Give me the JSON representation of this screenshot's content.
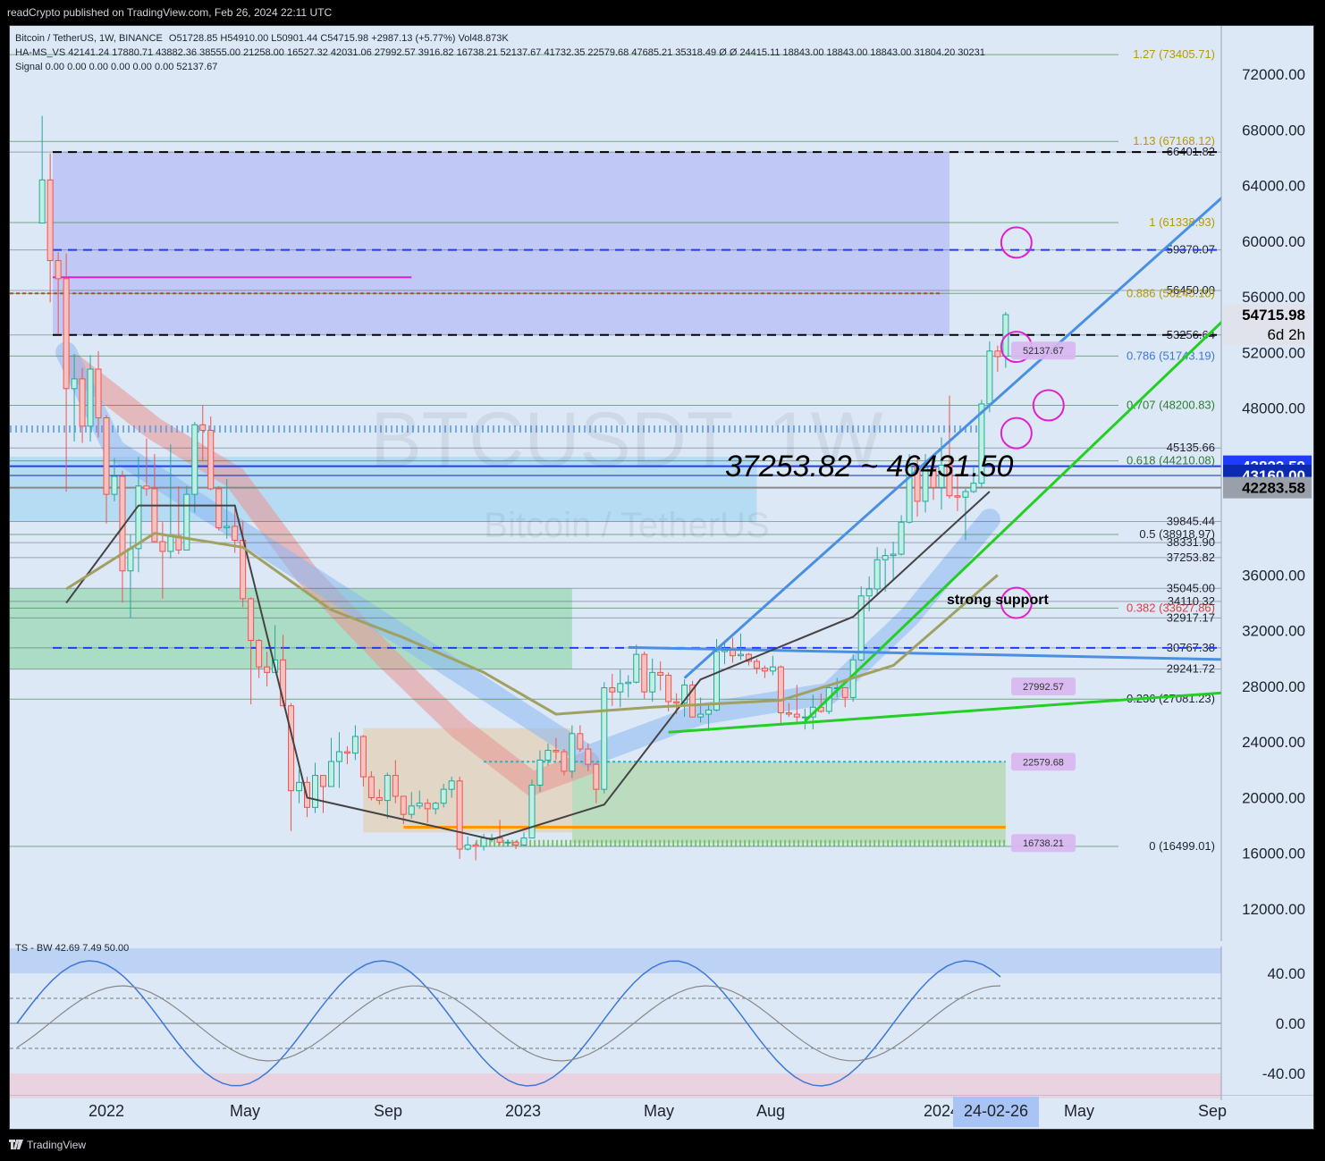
{
  "header": {
    "published": "readCrypto published on TradingView.com, Feb 26, 2024 22:11 UTC"
  },
  "symbol": {
    "name": "Bitcoin / TetherUS, 1W, BINANCE",
    "ohlc": "O51728.85 H54910.00 L50901.44 C54715.98 +2987.13 (+5.77%) Vol48.873K",
    "watermark": "BTCUSDT, 1W",
    "watermark_sub": "Bitcoin / TetherUS"
  },
  "indicators": {
    "ha_ms": "HA-MS_VS  42141.24  17880.71  43882.36  38555.00  21258.00  16527.32  42031.06  27992.57  3916.82  16738.21  52137.67  41732.35  22579.68  47685.21  35318.49  Ø  Ø  24415.11  18843.00  18843.00  18843.00  31804.20  30231",
    "signal": "Signal  0.00  0.00  0.00  0.00  0.00  0.00  52137.67",
    "oscillator": "TS - BW  42.69  7.49  50.00"
  },
  "colors": {
    "bg": "#dde8f7",
    "up": "#26a69a",
    "down": "#ef5350",
    "fib_line": "#2e7d32",
    "trend_blue": "#4a90e2",
    "trend_green": "#22d022",
    "box_blue": "#8a8ff0",
    "cloud_red": "#e89a98",
    "cloud_blue": "#8ab8f2",
    "magenta": "#e020d0",
    "orange": "#ff9800",
    "olive": "#a0a060"
  },
  "price_axis": {
    "ticks": [
      "72000.00",
      "68000.00",
      "64000.00",
      "60000.00",
      "56000.00",
      "52000.00",
      "48000.00",
      "36000.00",
      "32000.00",
      "28000.00",
      "24000.00",
      "20000.00",
      "16000.00",
      "12000.00"
    ],
    "current_price": "54715.98",
    "countdown": "6d 2h",
    "tag_blue": "43823.59",
    "tag_dark_blue": "43160.00",
    "tag_grey": "42283.58"
  },
  "fib_labels": [
    {
      "text": "1.27 (73405.71)",
      "value": 73405.71
    },
    {
      "text": "1.13 (67168.12)",
      "value": 67168.12
    },
    {
      "text": "1 (61338.93)",
      "value": 61338.93
    },
    {
      "text": "0.886 (56245.10)",
      "value": 56245.1
    },
    {
      "text": "0.786 (51743.19)",
      "value": 51743.19
    },
    {
      "text": "0.707 (48200.83)",
      "value": 48200.83
    },
    {
      "text": "0.618 (44210.08)",
      "value": 44210.08
    },
    {
      "text": "0.5 (38918.97)",
      "value": 38918.97
    },
    {
      "text": "0.382 (33627.86)",
      "value": 33627.86
    },
    {
      "text": "0.236 (27081.23)",
      "value": 27081.23
    },
    {
      "text": "0 (16499.01)",
      "value": 16499.01
    }
  ],
  "level_labels": [
    {
      "text": "66401.82",
      "value": 66401.82
    },
    {
      "text": "59370.07",
      "value": 59370.07
    },
    {
      "text": "56450.00",
      "value": 56450
    },
    {
      "text": "53256.64",
      "value": 53256.64
    },
    {
      "text": "45135.66",
      "value": 45135.66
    },
    {
      "text": "39845.44",
      "value": 39845.44
    },
    {
      "text": "38331.90",
      "value": 38331.9
    },
    {
      "text": "37253.82",
      "value": 37253.82
    },
    {
      "text": "35045.00",
      "value": 35045
    },
    {
      "text": "34110.32",
      "value": 34110.32
    },
    {
      "text": "32917.17",
      "value": 32917.17
    },
    {
      "text": "30767.38",
      "value": 30767.38
    },
    {
      "text": "29241.72",
      "value": 29241.72
    }
  ],
  "box_labels": [
    {
      "text": "52137.67",
      "value": 52137.67
    },
    {
      "text": "27992.57",
      "value": 27992.57
    },
    {
      "text": "22579.68",
      "value": 22579.68
    },
    {
      "text": "16738.21",
      "value": 16738.21
    }
  ],
  "annotations": {
    "range": "37253.82 ~ 46431.50",
    "support": "strong support"
  },
  "time_axis": {
    "labels": [
      "2022",
      "May",
      "Sep",
      "2023",
      "May",
      "Aug",
      "2024",
      "May",
      "Sep"
    ],
    "current_date": "24-02-26"
  },
  "osc_axis": {
    "ticks": [
      "40.00",
      "0.00",
      "-40.00"
    ]
  },
  "footer": {
    "brand": "TradingView"
  },
  "chart_data": {
    "type": "candlestick",
    "title": "BTCUSDT, 1W",
    "interval": "1W",
    "ylim": [
      10000,
      76000
    ],
    "x_start": "2021-11-01",
    "x_end": "2024-09-30",
    "series": [
      {
        "name": "Bitcoin / TetherUS",
        "points": [
          [
            "2021-11-08",
            61300,
            69000,
            62900,
            64400
          ],
          [
            "2021-11-15",
            64400,
            66300,
            55600,
            58600
          ],
          [
            "2021-11-22",
            58600,
            59200,
            53300,
            57300
          ],
          [
            "2021-11-29",
            57300,
            59100,
            42000,
            49400
          ],
          [
            "2021-12-06",
            49400,
            51900,
            45600,
            50100
          ],
          [
            "2021-12-13",
            50100,
            50900,
            45500,
            46700
          ],
          [
            "2021-12-20",
            46700,
            51800,
            45600,
            50800
          ],
          [
            "2021-12-27",
            50800,
            52100,
            45900,
            47300
          ],
          [
            "2022-01-03",
            47300,
            47500,
            39700,
            41800
          ],
          [
            "2022-01-10",
            41800,
            44400,
            41300,
            43100
          ],
          [
            "2022-01-17",
            43100,
            43500,
            34000,
            36300
          ],
          [
            "2022-01-24",
            36300,
            38900,
            32900,
            37900
          ],
          [
            "2022-01-31",
            37900,
            44500,
            36200,
            42400
          ],
          [
            "2022-02-07",
            42400,
            45800,
            41700,
            42200
          ],
          [
            "2022-02-14",
            42200,
            44700,
            39400,
            38400
          ],
          [
            "2022-02-21",
            38400,
            39800,
            34300,
            37700
          ],
          [
            "2022-02-28",
            37700,
            45400,
            37200,
            38800
          ],
          [
            "2022-03-07",
            38800,
            42400,
            37500,
            37800
          ],
          [
            "2022-03-14",
            37800,
            42400,
            38300,
            41800
          ],
          [
            "2022-03-21",
            41800,
            47000,
            40500,
            46800
          ],
          [
            "2022-03-28",
            46800,
            48200,
            44200,
            46400
          ],
          [
            "2022-04-04",
            46400,
            47400,
            42100,
            42200
          ],
          [
            "2022-04-11",
            42200,
            42400,
            39200,
            39400
          ],
          [
            "2022-04-18",
            39400,
            42900,
            38600,
            39500
          ],
          [
            "2022-04-25",
            39500,
            40800,
            37600,
            38500
          ],
          [
            "2022-05-02",
            38500,
            39900,
            33700,
            34300
          ],
          [
            "2022-05-09",
            34300,
            34400,
            26700,
            31300
          ],
          [
            "2022-05-16",
            31300,
            31400,
            28600,
            29400
          ],
          [
            "2022-05-23",
            29400,
            30500,
            28000,
            29000
          ],
          [
            "2022-05-30",
            29000,
            32400,
            29300,
            29900
          ],
          [
            "2022-06-06",
            29900,
            31700,
            26600,
            26600
          ],
          [
            "2022-06-13",
            26600,
            26800,
            17600,
            20500
          ],
          [
            "2022-06-20",
            20500,
            22000,
            19600,
            21100
          ],
          [
            "2022-06-27",
            21100,
            21500,
            18600,
            19300
          ],
          [
            "2022-07-04",
            19300,
            22500,
            18900,
            21600
          ],
          [
            "2022-07-11",
            21600,
            21600,
            18900,
            20800
          ],
          [
            "2022-07-18",
            20800,
            24300,
            20800,
            22600
          ],
          [
            "2022-07-25",
            22600,
            24700,
            20700,
            23300
          ],
          [
            "2022-08-01",
            23300,
            23700,
            22400,
            23200
          ],
          [
            "2022-08-08",
            23200,
            25200,
            22700,
            24400
          ],
          [
            "2022-08-15",
            24400,
            24500,
            20800,
            21500
          ],
          [
            "2022-08-22",
            21500,
            21900,
            19800,
            20000
          ],
          [
            "2022-08-29",
            20000,
            20600,
            19500,
            19800
          ],
          [
            "2022-09-05",
            19800,
            21800,
            18500,
            21600
          ],
          [
            "2022-09-12",
            21600,
            22700,
            19600,
            20100
          ],
          [
            "2022-09-19",
            20100,
            20100,
            18100,
            18800
          ],
          [
            "2022-09-26",
            18800,
            20400,
            18500,
            19400
          ],
          [
            "2022-10-03",
            19400,
            20500,
            19200,
            19600
          ],
          [
            "2022-10-10",
            19600,
            19900,
            18200,
            19200
          ],
          [
            "2022-10-17",
            19200,
            19700,
            18800,
            19600
          ],
          [
            "2022-10-24",
            19600,
            21000,
            19300,
            20600
          ],
          [
            "2022-10-31",
            20600,
            21500,
            20000,
            21200
          ],
          [
            "2022-11-07",
            21200,
            21500,
            15600,
            16300
          ],
          [
            "2022-11-14",
            16300,
            17200,
            16200,
            16600
          ],
          [
            "2022-11-21",
            16600,
            16800,
            15500,
            16500
          ],
          [
            "2022-11-28",
            16500,
            17400,
            16200,
            17100
          ],
          [
            "2022-12-05",
            17100,
            17400,
            16800,
            17100
          ],
          [
            "2022-12-12",
            17100,
            18400,
            16600,
            16800
          ],
          [
            "2022-12-19",
            16800,
            17000,
            16500,
            16800
          ],
          [
            "2022-12-26",
            16800,
            16900,
            16300,
            16600
          ],
          [
            "2023-01-02",
            16600,
            17500,
            16500,
            17100
          ],
          [
            "2023-01-09",
            17100,
            21300,
            17100,
            20900
          ],
          [
            "2023-01-16",
            20900,
            23400,
            20400,
            22700
          ],
          [
            "2023-01-23",
            22700,
            23900,
            22300,
            23400
          ],
          [
            "2023-01-30",
            23400,
            24300,
            22700,
            23300
          ],
          [
            "2023-02-06",
            23300,
            23500,
            21600,
            21900
          ],
          [
            "2023-02-13",
            21900,
            25200,
            21400,
            24600
          ],
          [
            "2023-02-20",
            24600,
            25200,
            23300,
            23500
          ],
          [
            "2023-02-27",
            23500,
            23900,
            21900,
            22400
          ],
          [
            "2023-03-06",
            22400,
            22500,
            19600,
            20600
          ],
          [
            "2023-03-13",
            20600,
            28300,
            20300,
            27900
          ],
          [
            "2023-03-20",
            27900,
            28900,
            26600,
            27600
          ],
          [
            "2023-03-27",
            27600,
            29200,
            26500,
            28200
          ],
          [
            "2023-04-03",
            28200,
            28800,
            27200,
            28300
          ],
          [
            "2023-04-10",
            28300,
            31000,
            28200,
            30300
          ],
          [
            "2023-04-17",
            30300,
            30500,
            27100,
            27600
          ],
          [
            "2023-04-24",
            27600,
            30000,
            26900,
            29000
          ],
          [
            "2023-05-01",
            29000,
            29800,
            27700,
            28800
          ],
          [
            "2023-05-08",
            28800,
            29000,
            26200,
            26900
          ],
          [
            "2023-05-15",
            26900,
            27500,
            26000,
            26800
          ],
          [
            "2023-05-22",
            26800,
            28500,
            25800,
            28100
          ],
          [
            "2023-05-29",
            28100,
            28400,
            26500,
            25800
          ],
          [
            "2023-06-05",
            25800,
            27200,
            25400,
            26000
          ],
          [
            "2023-06-12",
            26000,
            26800,
            24800,
            26300
          ],
          [
            "2023-06-19",
            26300,
            31400,
            26200,
            30500
          ],
          [
            "2023-06-26",
            30500,
            31300,
            29600,
            30600
          ],
          [
            "2023-07-03",
            30600,
            31500,
            29700,
            30200
          ],
          [
            "2023-07-10",
            30200,
            31800,
            29900,
            30300
          ],
          [
            "2023-07-17",
            30300,
            30400,
            29500,
            29800
          ],
          [
            "2023-07-24",
            29800,
            30000,
            28900,
            29300
          ],
          [
            "2023-07-31",
            29300,
            29500,
            28600,
            29100
          ],
          [
            "2023-08-07",
            29100,
            30200,
            28800,
            29400
          ],
          [
            "2023-08-14",
            29400,
            29500,
            25200,
            26100
          ],
          [
            "2023-08-21",
            26100,
            26800,
            25800,
            26000
          ],
          [
            "2023-08-28",
            26000,
            28100,
            25300,
            25800
          ],
          [
            "2023-09-04",
            25800,
            26400,
            24900,
            25800
          ],
          [
            "2023-09-11",
            25800,
            27400,
            24900,
            26500
          ],
          [
            "2023-09-18",
            26500,
            27500,
            26100,
            26200
          ],
          [
            "2023-09-25",
            26200,
            28000,
            26000,
            27900
          ],
          [
            "2023-10-02",
            27900,
            28600,
            27200,
            27900
          ],
          [
            "2023-10-09",
            27900,
            27900,
            26500,
            27200
          ],
          [
            "2023-10-16",
            27200,
            30300,
            26900,
            29900
          ],
          [
            "2023-10-23",
            29900,
            35200,
            29800,
            34500
          ],
          [
            "2023-10-30",
            34500,
            35900,
            33400,
            35000
          ],
          [
            "2023-11-06",
            35000,
            38000,
            34500,
            37100
          ],
          [
            "2023-11-13",
            37100,
            37900,
            34800,
            37400
          ],
          [
            "2023-11-20",
            37400,
            38400,
            35600,
            37500
          ],
          [
            "2023-11-27",
            37500,
            40300,
            37400,
            39800
          ],
          [
            "2023-12-04",
            39800,
            44700,
            39700,
            43800
          ],
          [
            "2023-12-11",
            43800,
            44400,
            40200,
            41300
          ],
          [
            "2023-12-18",
            41300,
            44700,
            40500,
            43700
          ],
          [
            "2023-12-25",
            43700,
            44200,
            41400,
            42300
          ],
          [
            "2024-01-01",
            42300,
            45900,
            40700,
            43900
          ],
          [
            "2024-01-08",
            43900,
            48900,
            41500,
            41700
          ],
          [
            "2024-01-15",
            41700,
            43200,
            40600,
            41600
          ],
          [
            "2024-01-22",
            41600,
            42200,
            38500,
            42000
          ],
          [
            "2024-01-29",
            42000,
            43800,
            41900,
            42600
          ],
          [
            "2024-02-05",
            42600,
            48600,
            42300,
            48300
          ],
          [
            "2024-02-12",
            48300,
            52800,
            47700,
            52100
          ],
          [
            "2024-02-19",
            52100,
            52500,
            50600,
            51700
          ],
          [
            "2024-02-26",
            51728.85,
            54910,
            50901.44,
            54715.98
          ]
        ]
      }
    ]
  }
}
